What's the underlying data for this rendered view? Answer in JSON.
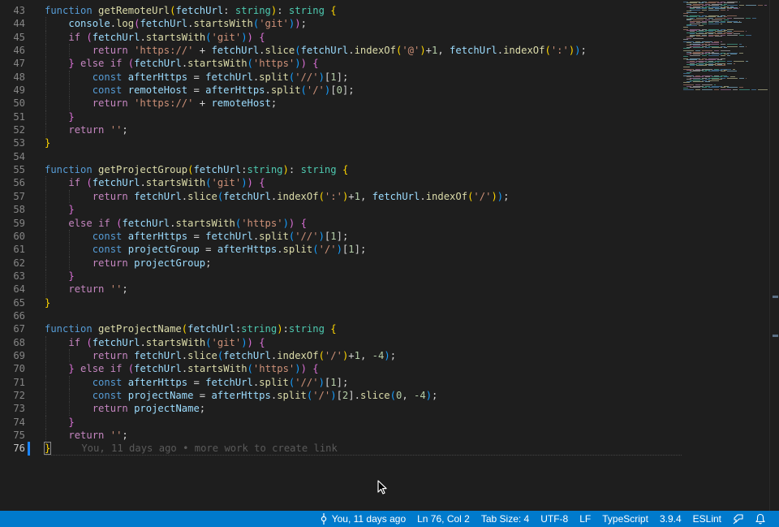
{
  "editor": {
    "first_line_number": 43,
    "current_line": 76,
    "lines": [
      [
        [
          "function ",
          "kw"
        ],
        [
          "getRemoteUrl",
          "fn"
        ],
        [
          "(",
          "p1"
        ],
        [
          "fetchUrl",
          "var"
        ],
        [
          ": ",
          ""
        ],
        [
          "string",
          "ty"
        ],
        [
          ")",
          "p1"
        ],
        [
          ": ",
          ""
        ],
        [
          "string",
          "ty"
        ],
        [
          " ",
          ""
        ],
        [
          "{",
          "p1"
        ]
      ],
      [
        [
          "    ",
          ""
        ],
        [
          "console",
          "var"
        ],
        [
          ".",
          ""
        ],
        [
          "log",
          "fn"
        ],
        [
          "(",
          "p2"
        ],
        [
          "fetchUrl",
          "var"
        ],
        [
          ".",
          ""
        ],
        [
          "startsWith",
          "fn"
        ],
        [
          "(",
          "p3"
        ],
        [
          "'git'",
          "str"
        ],
        [
          ")",
          "p3"
        ],
        [
          ")",
          "p2"
        ],
        [
          ";",
          ""
        ]
      ],
      [
        [
          "    ",
          ""
        ],
        [
          "if",
          "ctl"
        ],
        [
          " ",
          ""
        ],
        [
          "(",
          "p2"
        ],
        [
          "fetchUrl",
          "var"
        ],
        [
          ".",
          ""
        ],
        [
          "startsWith",
          "fn"
        ],
        [
          "(",
          "p3"
        ],
        [
          "'git'",
          "str"
        ],
        [
          ")",
          "p3"
        ],
        [
          ")",
          "p2"
        ],
        [
          " ",
          ""
        ],
        [
          "{",
          "p2"
        ]
      ],
      [
        [
          "        ",
          ""
        ],
        [
          "return",
          "ctl"
        ],
        [
          " ",
          ""
        ],
        [
          "'https://'",
          "str"
        ],
        [
          " + ",
          ""
        ],
        [
          "fetchUrl",
          "var"
        ],
        [
          ".",
          ""
        ],
        [
          "slice",
          "fn"
        ],
        [
          "(",
          "p3"
        ],
        [
          "fetchUrl",
          "var"
        ],
        [
          ".",
          ""
        ],
        [
          "indexOf",
          "fn"
        ],
        [
          "(",
          "p1"
        ],
        [
          "'@'",
          "str"
        ],
        [
          ")",
          "p1"
        ],
        [
          "+",
          ""
        ],
        [
          "1",
          "num"
        ],
        [
          ", ",
          ""
        ],
        [
          "fetchUrl",
          "var"
        ],
        [
          ".",
          ""
        ],
        [
          "indexOf",
          "fn"
        ],
        [
          "(",
          "p1"
        ],
        [
          "':'",
          "str"
        ],
        [
          ")",
          "p1"
        ],
        [
          ")",
          "p3"
        ],
        [
          ";",
          ""
        ]
      ],
      [
        [
          "    ",
          ""
        ],
        [
          "}",
          "p2"
        ],
        [
          " ",
          ""
        ],
        [
          "else",
          "ctl"
        ],
        [
          " ",
          ""
        ],
        [
          "if",
          "ctl"
        ],
        [
          " ",
          ""
        ],
        [
          "(",
          "p2"
        ],
        [
          "fetchUrl",
          "var"
        ],
        [
          ".",
          ""
        ],
        [
          "startsWith",
          "fn"
        ],
        [
          "(",
          "p3"
        ],
        [
          "'https'",
          "str"
        ],
        [
          ")",
          "p3"
        ],
        [
          ")",
          "p2"
        ],
        [
          " ",
          ""
        ],
        [
          "{",
          "p2"
        ]
      ],
      [
        [
          "        ",
          ""
        ],
        [
          "const",
          "kw"
        ],
        [
          " ",
          ""
        ],
        [
          "afterHttps",
          "var"
        ],
        [
          " = ",
          ""
        ],
        [
          "fetchUrl",
          "var"
        ],
        [
          ".",
          ""
        ],
        [
          "split",
          "fn"
        ],
        [
          "(",
          "p3"
        ],
        [
          "'//'",
          "str"
        ],
        [
          ")",
          "p3"
        ],
        [
          "[",
          ""
        ],
        [
          "1",
          "num"
        ],
        [
          "]",
          ""
        ],
        [
          ";",
          ""
        ]
      ],
      [
        [
          "        ",
          ""
        ],
        [
          "const",
          "kw"
        ],
        [
          " ",
          ""
        ],
        [
          "remoteHost",
          "var"
        ],
        [
          " = ",
          ""
        ],
        [
          "afterHttps",
          "var"
        ],
        [
          ".",
          ""
        ],
        [
          "split",
          "fn"
        ],
        [
          "(",
          "p3"
        ],
        [
          "'/'",
          "str"
        ],
        [
          ")",
          "p3"
        ],
        [
          "[",
          ""
        ],
        [
          "0",
          "num"
        ],
        [
          "]",
          ""
        ],
        [
          ";",
          ""
        ]
      ],
      [
        [
          "        ",
          ""
        ],
        [
          "return",
          "ctl"
        ],
        [
          " ",
          ""
        ],
        [
          "'https://'",
          "str"
        ],
        [
          " + ",
          ""
        ],
        [
          "remoteHost",
          "var"
        ],
        [
          ";",
          ""
        ]
      ],
      [
        [
          "    ",
          ""
        ],
        [
          "}",
          "p2"
        ]
      ],
      [
        [
          "    ",
          ""
        ],
        [
          "return",
          "ctl"
        ],
        [
          " ",
          ""
        ],
        [
          "''",
          "str"
        ],
        [
          ";",
          ""
        ]
      ],
      [
        [
          "}",
          "p1"
        ]
      ],
      [],
      [
        [
          "function ",
          "kw"
        ],
        [
          "getProjectGroup",
          "fn"
        ],
        [
          "(",
          "p1"
        ],
        [
          "fetchUrl",
          "var"
        ],
        [
          ":",
          ""
        ],
        [
          "string",
          "ty"
        ],
        [
          ")",
          "p1"
        ],
        [
          ": ",
          ""
        ],
        [
          "string",
          "ty"
        ],
        [
          " ",
          ""
        ],
        [
          "{",
          "p1"
        ]
      ],
      [
        [
          "    ",
          ""
        ],
        [
          "if",
          "ctl"
        ],
        [
          " ",
          ""
        ],
        [
          "(",
          "p2"
        ],
        [
          "fetchUrl",
          "var"
        ],
        [
          ".",
          ""
        ],
        [
          "startsWith",
          "fn"
        ],
        [
          "(",
          "p3"
        ],
        [
          "'git'",
          "str"
        ],
        [
          ")",
          "p3"
        ],
        [
          ")",
          "p2"
        ],
        [
          " ",
          ""
        ],
        [
          "{",
          "p2"
        ]
      ],
      [
        [
          "        ",
          ""
        ],
        [
          "return",
          "ctl"
        ],
        [
          " ",
          ""
        ],
        [
          "fetchUrl",
          "var"
        ],
        [
          ".",
          ""
        ],
        [
          "slice",
          "fn"
        ],
        [
          "(",
          "p3"
        ],
        [
          "fetchUrl",
          "var"
        ],
        [
          ".",
          ""
        ],
        [
          "indexOf",
          "fn"
        ],
        [
          "(",
          "p1"
        ],
        [
          "':'",
          "str"
        ],
        [
          ")",
          "p1"
        ],
        [
          "+",
          ""
        ],
        [
          "1",
          "num"
        ],
        [
          ", ",
          ""
        ],
        [
          "fetchUrl",
          "var"
        ],
        [
          ".",
          ""
        ],
        [
          "indexOf",
          "fn"
        ],
        [
          "(",
          "p1"
        ],
        [
          "'/'",
          "str"
        ],
        [
          ")",
          "p1"
        ],
        [
          ")",
          "p3"
        ],
        [
          ";",
          ""
        ]
      ],
      [
        [
          "    ",
          ""
        ],
        [
          "}",
          "p2"
        ]
      ],
      [
        [
          "    ",
          ""
        ],
        [
          "else",
          "ctl"
        ],
        [
          " ",
          ""
        ],
        [
          "if",
          "ctl"
        ],
        [
          " ",
          ""
        ],
        [
          "(",
          "p2"
        ],
        [
          "fetchUrl",
          "var"
        ],
        [
          ".",
          ""
        ],
        [
          "startsWith",
          "fn"
        ],
        [
          "(",
          "p3"
        ],
        [
          "'https'",
          "str"
        ],
        [
          ")",
          "p3"
        ],
        [
          ")",
          "p2"
        ],
        [
          " ",
          ""
        ],
        [
          "{",
          "p2"
        ]
      ],
      [
        [
          "        ",
          ""
        ],
        [
          "const",
          "kw"
        ],
        [
          " ",
          ""
        ],
        [
          "afterHttps",
          "var"
        ],
        [
          " = ",
          ""
        ],
        [
          "fetchUrl",
          "var"
        ],
        [
          ".",
          ""
        ],
        [
          "split",
          "fn"
        ],
        [
          "(",
          "p3"
        ],
        [
          "'//'",
          "str"
        ],
        [
          ")",
          "p3"
        ],
        [
          "[",
          ""
        ],
        [
          "1",
          "num"
        ],
        [
          "]",
          ""
        ],
        [
          ";",
          ""
        ]
      ],
      [
        [
          "        ",
          ""
        ],
        [
          "const",
          "kw"
        ],
        [
          " ",
          ""
        ],
        [
          "projectGroup",
          "var"
        ],
        [
          " = ",
          ""
        ],
        [
          "afterHttps",
          "var"
        ],
        [
          ".",
          ""
        ],
        [
          "split",
          "fn"
        ],
        [
          "(",
          "p3"
        ],
        [
          "'/'",
          "str"
        ],
        [
          ")",
          "p3"
        ],
        [
          "[",
          ""
        ],
        [
          "1",
          "num"
        ],
        [
          "]",
          ""
        ],
        [
          ";",
          ""
        ]
      ],
      [
        [
          "        ",
          ""
        ],
        [
          "return",
          "ctl"
        ],
        [
          " ",
          ""
        ],
        [
          "projectGroup",
          "var"
        ],
        [
          ";",
          ""
        ]
      ],
      [
        [
          "    ",
          ""
        ],
        [
          "}",
          "p2"
        ]
      ],
      [
        [
          "    ",
          ""
        ],
        [
          "return",
          "ctl"
        ],
        [
          " ",
          ""
        ],
        [
          "''",
          "str"
        ],
        [
          ";",
          ""
        ]
      ],
      [
        [
          "}",
          "p1"
        ]
      ],
      [],
      [
        [
          "function ",
          "kw"
        ],
        [
          "getProjectName",
          "fn"
        ],
        [
          "(",
          "p1"
        ],
        [
          "fetchUrl",
          "var"
        ],
        [
          ":",
          ""
        ],
        [
          "string",
          "ty"
        ],
        [
          ")",
          "p1"
        ],
        [
          ":",
          ""
        ],
        [
          "string",
          "ty"
        ],
        [
          " ",
          ""
        ],
        [
          "{",
          "p1"
        ]
      ],
      [
        [
          "    ",
          ""
        ],
        [
          "if",
          "ctl"
        ],
        [
          " ",
          ""
        ],
        [
          "(",
          "p2"
        ],
        [
          "fetchUrl",
          "var"
        ],
        [
          ".",
          ""
        ],
        [
          "startsWith",
          "fn"
        ],
        [
          "(",
          "p3"
        ],
        [
          "'git'",
          "str"
        ],
        [
          ")",
          "p3"
        ],
        [
          ")",
          "p2"
        ],
        [
          " ",
          ""
        ],
        [
          "{",
          "p2"
        ]
      ],
      [
        [
          "        ",
          ""
        ],
        [
          "return",
          "ctl"
        ],
        [
          " ",
          ""
        ],
        [
          "fetchUrl",
          "var"
        ],
        [
          ".",
          ""
        ],
        [
          "slice",
          "fn"
        ],
        [
          "(",
          "p3"
        ],
        [
          "fetchUrl",
          "var"
        ],
        [
          ".",
          ""
        ],
        [
          "indexOf",
          "fn"
        ],
        [
          "(",
          "p1"
        ],
        [
          "'/'",
          "str"
        ],
        [
          ")",
          "p1"
        ],
        [
          "+",
          ""
        ],
        [
          "1",
          "num"
        ],
        [
          ", ",
          ""
        ],
        [
          "-4",
          "num"
        ],
        [
          ")",
          "p3"
        ],
        [
          ";",
          ""
        ]
      ],
      [
        [
          "    ",
          ""
        ],
        [
          "}",
          "p2"
        ],
        [
          " ",
          ""
        ],
        [
          "else",
          "ctl"
        ],
        [
          " ",
          ""
        ],
        [
          "if",
          "ctl"
        ],
        [
          " ",
          ""
        ],
        [
          "(",
          "p2"
        ],
        [
          "fetchUrl",
          "var"
        ],
        [
          ".",
          ""
        ],
        [
          "startsWith",
          "fn"
        ],
        [
          "(",
          "p3"
        ],
        [
          "'https'",
          "str"
        ],
        [
          ")",
          "p3"
        ],
        [
          ")",
          "p2"
        ],
        [
          " ",
          ""
        ],
        [
          "{",
          "p2"
        ]
      ],
      [
        [
          "        ",
          ""
        ],
        [
          "const",
          "kw"
        ],
        [
          " ",
          ""
        ],
        [
          "afterHttps",
          "var"
        ],
        [
          " = ",
          ""
        ],
        [
          "fetchUrl",
          "var"
        ],
        [
          ".",
          ""
        ],
        [
          "split",
          "fn"
        ],
        [
          "(",
          "p3"
        ],
        [
          "'//'",
          "str"
        ],
        [
          ")",
          "p3"
        ],
        [
          "[",
          ""
        ],
        [
          "1",
          "num"
        ],
        [
          "]",
          ""
        ],
        [
          ";",
          ""
        ]
      ],
      [
        [
          "        ",
          ""
        ],
        [
          "const",
          "kw"
        ],
        [
          " ",
          ""
        ],
        [
          "projectName",
          "var"
        ],
        [
          " = ",
          ""
        ],
        [
          "afterHttps",
          "var"
        ],
        [
          ".",
          ""
        ],
        [
          "split",
          "fn"
        ],
        [
          "(",
          "p3"
        ],
        [
          "'/'",
          "str"
        ],
        [
          ")",
          "p3"
        ],
        [
          "[",
          ""
        ],
        [
          "2",
          "num"
        ],
        [
          "]",
          ""
        ],
        [
          ".",
          ""
        ],
        [
          "slice",
          "fn"
        ],
        [
          "(",
          "p3"
        ],
        [
          "0",
          "num"
        ],
        [
          ", ",
          ""
        ],
        [
          "-4",
          "num"
        ],
        [
          ")",
          "p3"
        ],
        [
          ";",
          ""
        ]
      ],
      [
        [
          "        ",
          ""
        ],
        [
          "return",
          "ctl"
        ],
        [
          " ",
          ""
        ],
        [
          "projectName",
          "var"
        ],
        [
          ";",
          ""
        ]
      ],
      [
        [
          "    ",
          ""
        ],
        [
          "}",
          "p2"
        ]
      ],
      [
        [
          "    ",
          ""
        ],
        [
          "return",
          "ctl"
        ],
        [
          " ",
          ""
        ],
        [
          "''",
          "str"
        ],
        [
          ";",
          ""
        ]
      ],
      [
        [
          "}",
          "p1"
        ]
      ]
    ],
    "inline_blame": "You, 11 days ago • more work to create link"
  },
  "statusbar": {
    "blame": "You, 11 days ago",
    "position": "Ln 76, Col 2",
    "tab_size": "Tab Size: 4",
    "encoding": "UTF-8",
    "eol": "LF",
    "language": "TypeScript",
    "ts_version": "3.9.4",
    "linter": "ESLint"
  },
  "colors": {
    "editor_bg": "#1e1e1e",
    "statusbar_bg": "#007acc",
    "keyword": "#569cd6",
    "control": "#c586c0",
    "function": "#dcdcaa",
    "variable": "#9cdcfe",
    "type": "#4ec9b0",
    "string": "#ce9178",
    "number": "#b5cea8"
  },
  "icons": {
    "blame": "git-commit-icon",
    "feedback": "feedback-icon",
    "notifications": "bell-icon"
  }
}
